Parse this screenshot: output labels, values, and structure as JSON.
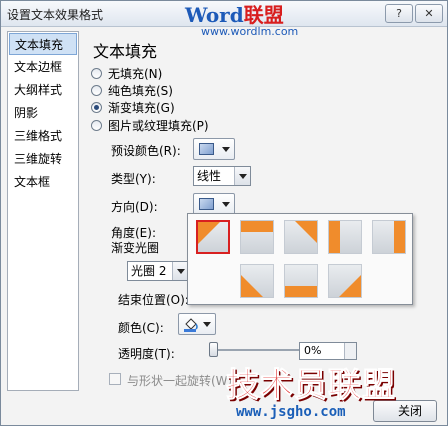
{
  "window": {
    "title": "设置文本效果格式",
    "help_label": "?",
    "close_label": "✕"
  },
  "watermark": {
    "brand_word": "Word",
    "brand_cn": "联盟",
    "url": "www.wordlm.com"
  },
  "sidebar": {
    "items": [
      {
        "label": "文本填充",
        "selected": true
      },
      {
        "label": "文本边框"
      },
      {
        "label": "大纲样式"
      },
      {
        "label": "阴影"
      },
      {
        "label": "三维格式"
      },
      {
        "label": "三维旋转"
      },
      {
        "label": "文本框"
      }
    ]
  },
  "main": {
    "heading": "文本填充",
    "fill_options": [
      {
        "label": "无填充(N)",
        "checked": false
      },
      {
        "label": "纯色填充(S)",
        "checked": false
      },
      {
        "label": "渐变填充(G)",
        "checked": true
      },
      {
        "label": "图片或纹理填充(P)",
        "checked": false
      }
    ],
    "preset_colors_label": "预设颜色(R):",
    "type_label": "类型(Y):",
    "type_value": "线性",
    "direction_label": "方向(D):",
    "angle_label": "角度(E):",
    "gradient_stops_label": "渐变光圈",
    "stop_value": "光圈 2",
    "end_position_label": "结束位置(O):",
    "color_label": "颜色(C):",
    "transparency_label": "透明度(T):",
    "transparency_value": "0%",
    "rotate_label": "与形状一起旋转(W)",
    "close_button": "关闭"
  },
  "direction_popup": {
    "tiles": [
      "linear-diagonal-top-left-to-bottom-right",
      "linear-down",
      "linear-diagonal-top-right-to-bottom-left",
      "linear-right",
      "linear-left",
      "linear-diagonal-bottom-left-to-top-right",
      "linear-up",
      "linear-diagonal-bottom-right-to-top-left"
    ],
    "selected_index": 0
  },
  "overlay_brand": {
    "text": "技术员联盟",
    "url": "www.jsgho.com"
  },
  "colors": {
    "accent_orange": "#f08c2c",
    "selection_red": "#d82020",
    "brand_red": "#e02424",
    "brand_blue": "#1b5fb8"
  }
}
